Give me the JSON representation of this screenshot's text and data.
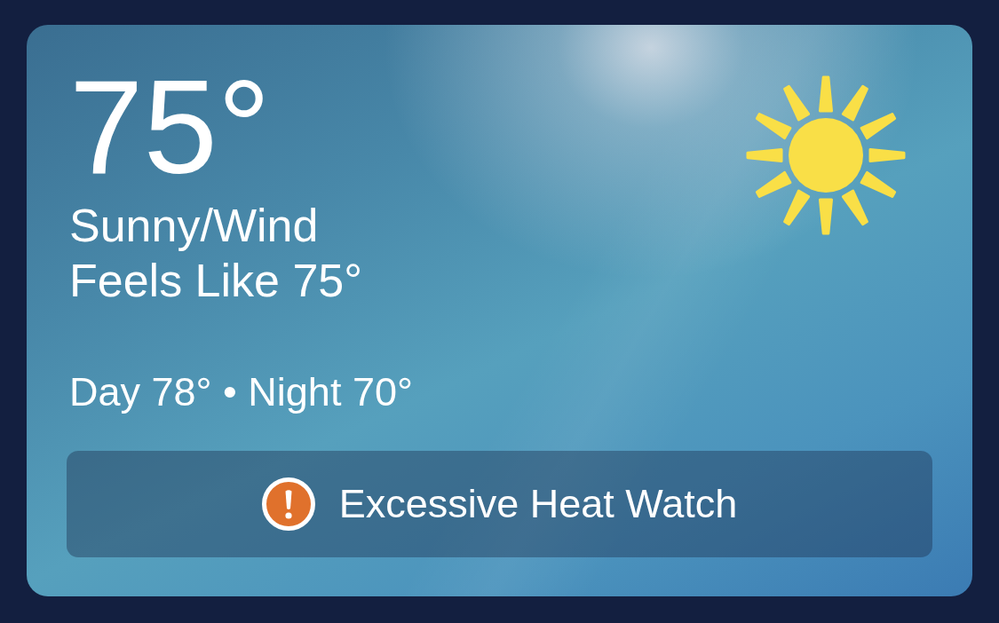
{
  "current": {
    "temperature": "75°",
    "condition": "Sunny/Wind",
    "feels_like": "Feels Like 75°"
  },
  "forecast": {
    "day_night": "Day 78° • Night 70°"
  },
  "alert": {
    "label": "Excessive Heat Watch"
  }
}
